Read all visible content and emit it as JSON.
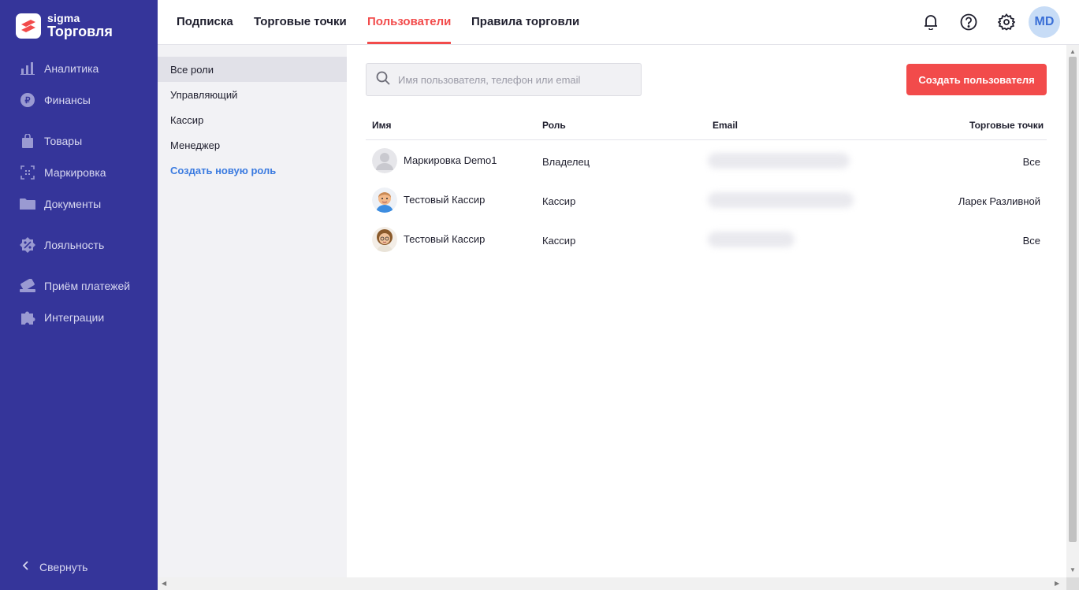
{
  "brand": {
    "name": "sigma",
    "product": "Торговля",
    "accent": "#f24b4b",
    "sidebar_bg": "#35359a"
  },
  "sidebar": {
    "items": [
      {
        "label": "Аналитика",
        "icon": "bar-chart-icon"
      },
      {
        "label": "Финансы",
        "icon": "ruble-coin-icon"
      },
      {
        "label": "Товары",
        "icon": "shopping-bag-icon"
      },
      {
        "label": "Маркировка",
        "icon": "datamatrix-scan-icon"
      },
      {
        "label": "Документы",
        "icon": "folder-icon"
      },
      {
        "label": "Лояльность",
        "icon": "percent-badge-icon"
      },
      {
        "label": "Приём платежей",
        "icon": "payment-card-icon"
      },
      {
        "label": "Интеграции",
        "icon": "puzzle-icon"
      }
    ],
    "collapse_label": "Свернуть"
  },
  "topnav": {
    "tabs": [
      {
        "label": "Подписка"
      },
      {
        "label": "Торговые точки"
      },
      {
        "label": "Пользователи",
        "active": true
      },
      {
        "label": "Правила торговли"
      }
    ],
    "user_initials": "MD"
  },
  "roles": {
    "items": [
      "Все роли",
      "Управляющий",
      "Кассир",
      "Менеджер"
    ],
    "create_label": "Создать новую роль"
  },
  "main": {
    "search_placeholder": "Имя пользователя, телефон или email",
    "create_button": "Создать пользователя",
    "columns": {
      "name": "Имя",
      "role": "Роль",
      "email": "Email",
      "shops": "Торговые точки"
    },
    "rows": [
      {
        "name": "Маркировка Demo1",
        "role": "Владелец",
        "email": "",
        "shops": "Все",
        "avatar": "placeholder-avatar-icon"
      },
      {
        "name": "Тестовый Кассир",
        "role": "Кассир",
        "email": "",
        "shops": "Ларек Разливной",
        "avatar": "bald-man-avatar-icon"
      },
      {
        "name": "Тестовый Кассир",
        "role": "Кассир",
        "email": "",
        "shops": "Все",
        "avatar": "curly-woman-avatar-icon"
      }
    ]
  }
}
